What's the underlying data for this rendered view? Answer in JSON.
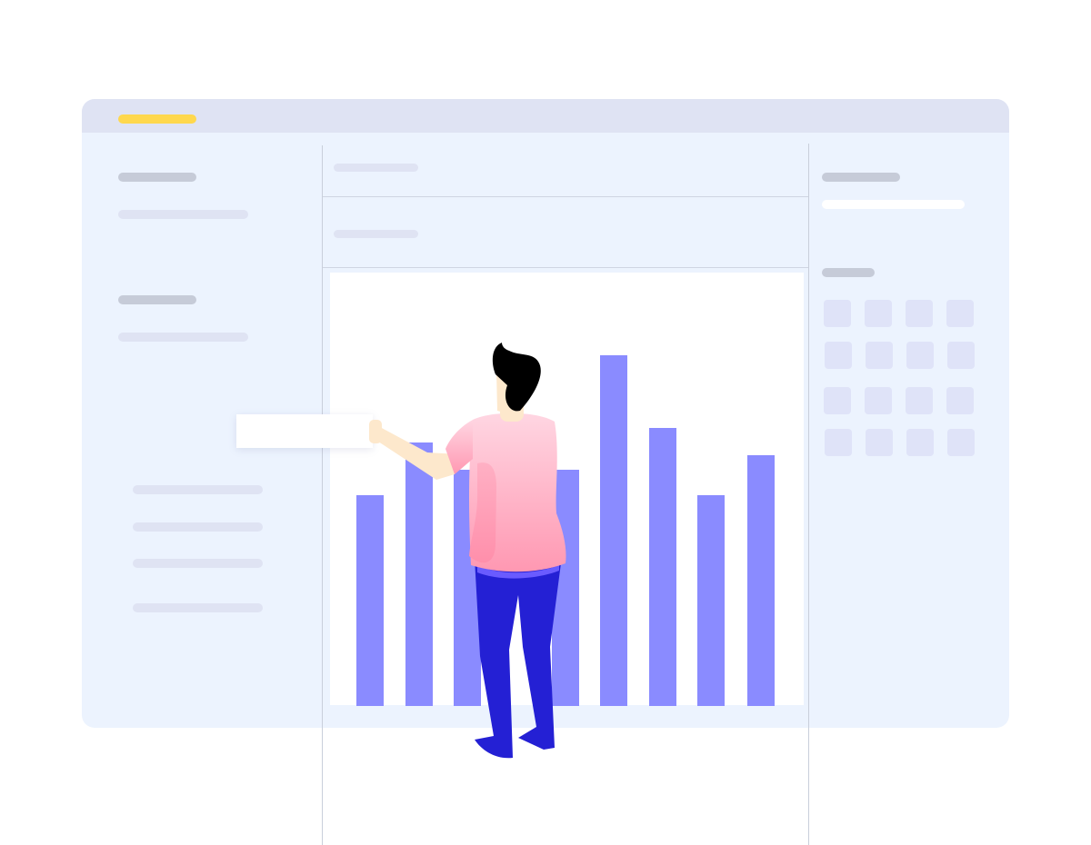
{
  "window": {
    "titlebar_color": "#dfe3f3",
    "accent_color": "#ffd84d",
    "background": "#ecf3fe"
  },
  "chart_data": {
    "type": "bar",
    "categories": [
      "",
      "",
      "",
      "",
      "",
      "",
      "",
      "",
      ""
    ],
    "values": [
      232,
      290,
      260,
      260,
      386,
      306,
      232,
      276,
      0
    ],
    "ylim": [
      0,
      476
    ],
    "bar_color": "#8a8bff",
    "grid": false
  },
  "illustration": {
    "figure": "person-pointing-at-chart",
    "shirt_colors": [
      "#ffd3df",
      "#ff9fb8"
    ],
    "pants_color": "#2420d4",
    "skin_color": "#fde8cc",
    "hair_color": "#000000"
  },
  "right_panel": {
    "tile_color": "#dfe3f8",
    "tile_rows": 4,
    "tile_cols": 4
  }
}
